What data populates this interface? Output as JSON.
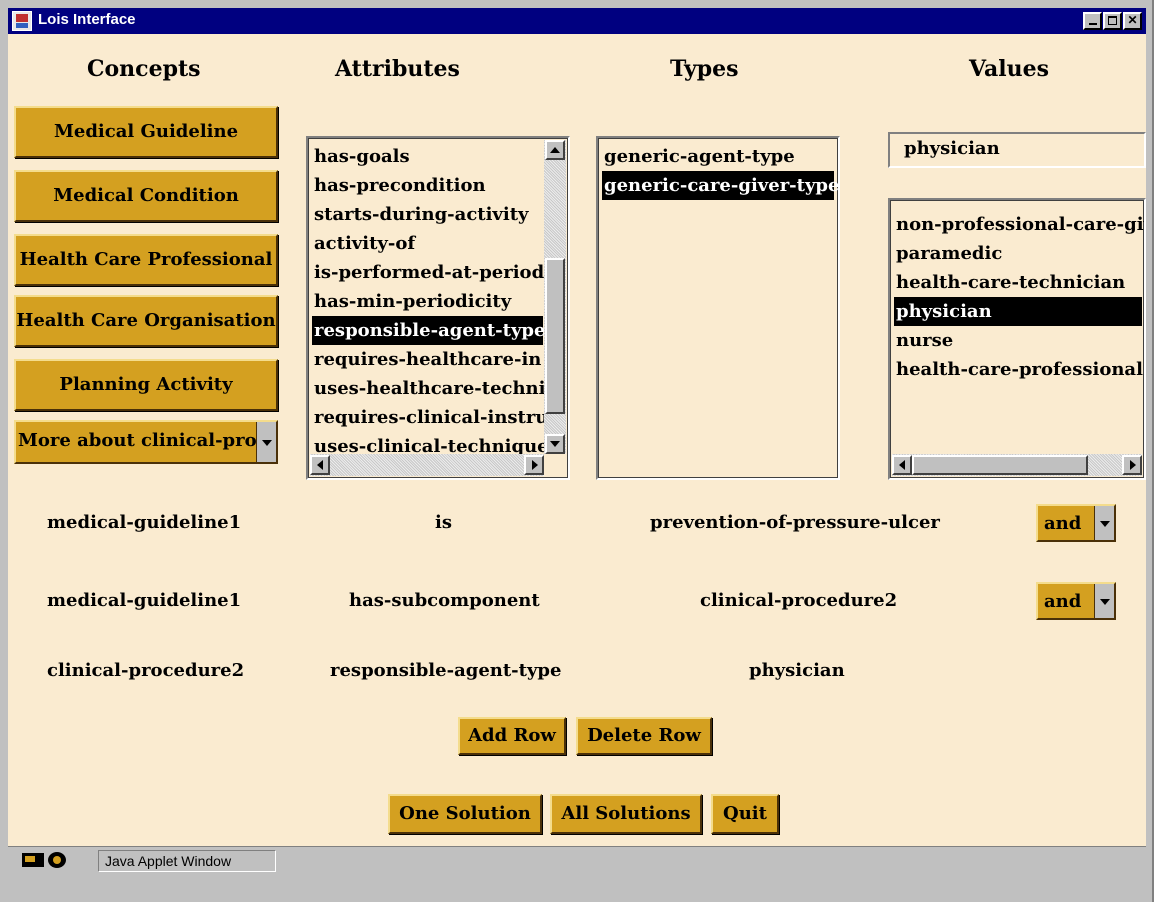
{
  "window": {
    "title": "Lois Interface"
  },
  "headers": {
    "concepts": "Concepts",
    "attributes": "Attributes",
    "types": "Types",
    "values": "Values"
  },
  "concepts": {
    "buttons": [
      "Medical Guideline",
      "Medical Condition",
      "Health Care Professional",
      "Health Care Organisation",
      "Planning Activity"
    ],
    "more_dropdown": "More about clinical-pro"
  },
  "attributes": {
    "items": [
      "has-goals",
      "has-precondition",
      "starts-during-activity",
      "activity-of",
      "is-performed-at-period",
      "has-min-periodicity",
      "responsible-agent-type",
      "requires-healthcare-in",
      "uses-healthcare-techni",
      "requires-clinical-instru",
      "uses-clinical-technique"
    ],
    "selected_index": 6
  },
  "types": {
    "items": [
      "generic-agent-type",
      "generic-care-giver-type"
    ],
    "selected_index": 1
  },
  "values": {
    "input_value": "physician",
    "items": [
      "non-professional-care-giv",
      "paramedic",
      "health-care-technician",
      "physician",
      "nurse",
      "health-care-professional"
    ],
    "selected_index": 3
  },
  "query_rows": [
    {
      "concept": "medical-guideline1",
      "attribute": "is",
      "value": "prevention-of-pressure-ulcer",
      "connector": "and"
    },
    {
      "concept": "medical-guideline1",
      "attribute": "has-subcomponent",
      "value": "clinical-procedure2",
      "connector": "and"
    },
    {
      "concept": "clinical-procedure2",
      "attribute": "responsible-agent-type",
      "value": "physician"
    }
  ],
  "actions": {
    "add_row": "Add Row",
    "delete_row": "Delete Row",
    "one_solution": "One Solution",
    "all_solutions": "All Solutions",
    "quit": "Quit"
  },
  "status": {
    "text": "Java Applet Window"
  },
  "colors": {
    "titlebar": "#000080",
    "panel": "#faebd0",
    "button": "#d4a020",
    "selection": "#000000"
  }
}
